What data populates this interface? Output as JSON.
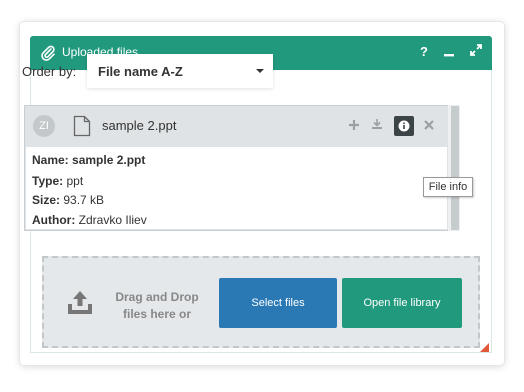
{
  "window": {
    "title": "Uploaded files",
    "help_label": "?",
    "accent": "#21997d"
  },
  "order": {
    "label": "Order by:",
    "selected": "File name A-Z"
  },
  "file": {
    "avatar_initials": "ZI",
    "name": "sample 2.ppt",
    "details": {
      "name_label": "Name:",
      "name_value": "sample 2.ppt",
      "type_label": "Type:",
      "type_value": "ppt",
      "size_label": "Size:",
      "size_value": "93.7 kB",
      "author_label": "Author:",
      "author_value": "Zdravko Iliev"
    },
    "actions": [
      "add-icon",
      "download-icon",
      "info-icon",
      "close-icon"
    ]
  },
  "tooltip": "File info",
  "dropzone": {
    "drag_text_line1": "Drag and Drop",
    "drag_text_line2": "files here or",
    "select_label": "Select files",
    "library_label": "Open file library",
    "select_color": "#2a79b5",
    "library_color": "#21997d"
  }
}
